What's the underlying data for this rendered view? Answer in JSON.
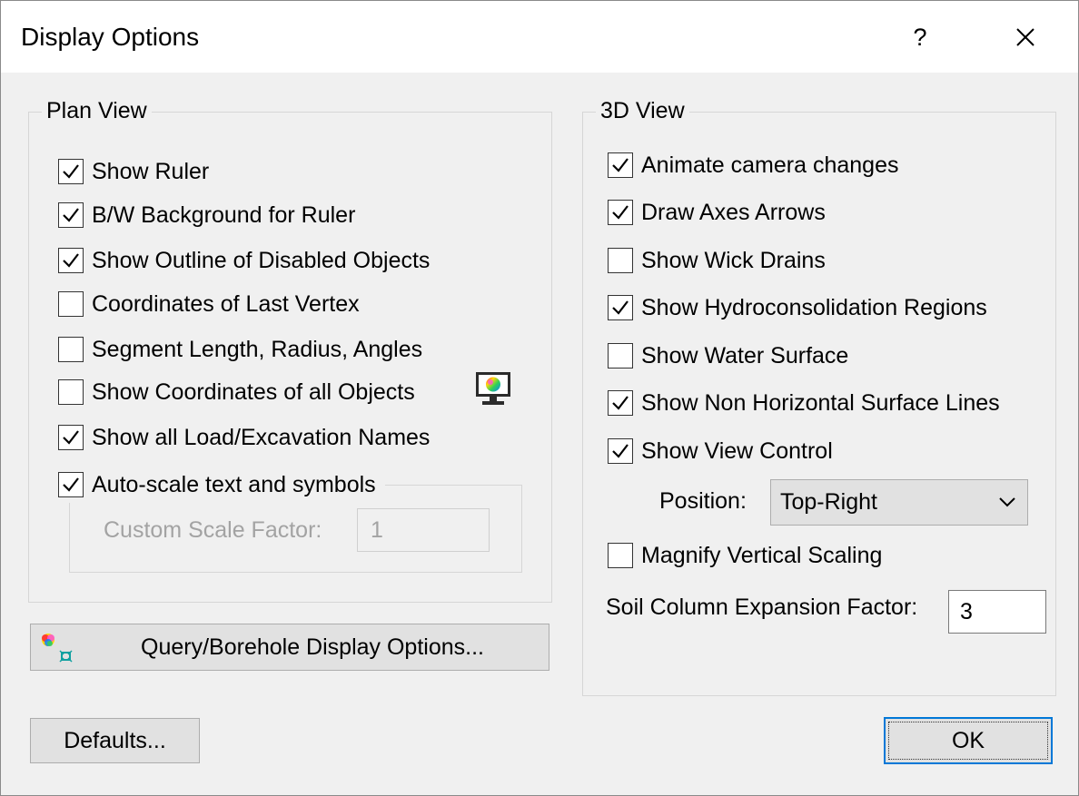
{
  "window": {
    "title": "Display Options",
    "help_glyph": "?"
  },
  "plan_view": {
    "title": "Plan View",
    "items": [
      {
        "label": "Show Ruler",
        "checked": true
      },
      {
        "label": "B/W Background for Ruler",
        "checked": true
      },
      {
        "label": "Show Outline of Disabled Objects",
        "checked": true
      },
      {
        "label": "Coordinates of Last Vertex",
        "checked": false
      },
      {
        "label": "Segment Length, Radius, Angles",
        "checked": false
      },
      {
        "label": "Show Coordinates of all Objects",
        "checked": false
      },
      {
        "label": "Show all Load/Excavation Names",
        "checked": true
      },
      {
        "label": "Auto-scale text and symbols",
        "checked": true
      }
    ],
    "custom_scale_label": "Custom Scale Factor:",
    "custom_scale_value": "1",
    "coords_icon": "color-monitor-icon"
  },
  "query_button": {
    "label": "Query/Borehole Display Options...",
    "icon": "color-wheel-icon"
  },
  "view_3d": {
    "title": "3D View",
    "items": [
      {
        "label": "Animate camera changes",
        "checked": true
      },
      {
        "label": "Draw Axes Arrows",
        "checked": true
      },
      {
        "label": "Show Wick Drains",
        "checked": false
      },
      {
        "label": "Show Hydroconsolidation Regions",
        "checked": true
      },
      {
        "label": "Show Water Surface",
        "checked": false
      },
      {
        "label": "Show Non Horizontal Surface Lines",
        "checked": true
      },
      {
        "label": "Show View Control",
        "checked": true
      },
      {
        "label": "Magnify Vertical Scaling",
        "checked": false
      }
    ],
    "position_label": "Position:",
    "position_value": "Top-Right",
    "soil_label": "Soil Column Expansion Factor:",
    "soil_value": "3"
  },
  "footer": {
    "defaults_label": "Defaults...",
    "ok_label": "OK"
  },
  "colors": {
    "focus_border": "#0078d7",
    "button_face": "#e1e1e1",
    "dialog_bg": "#f0f0f0"
  }
}
